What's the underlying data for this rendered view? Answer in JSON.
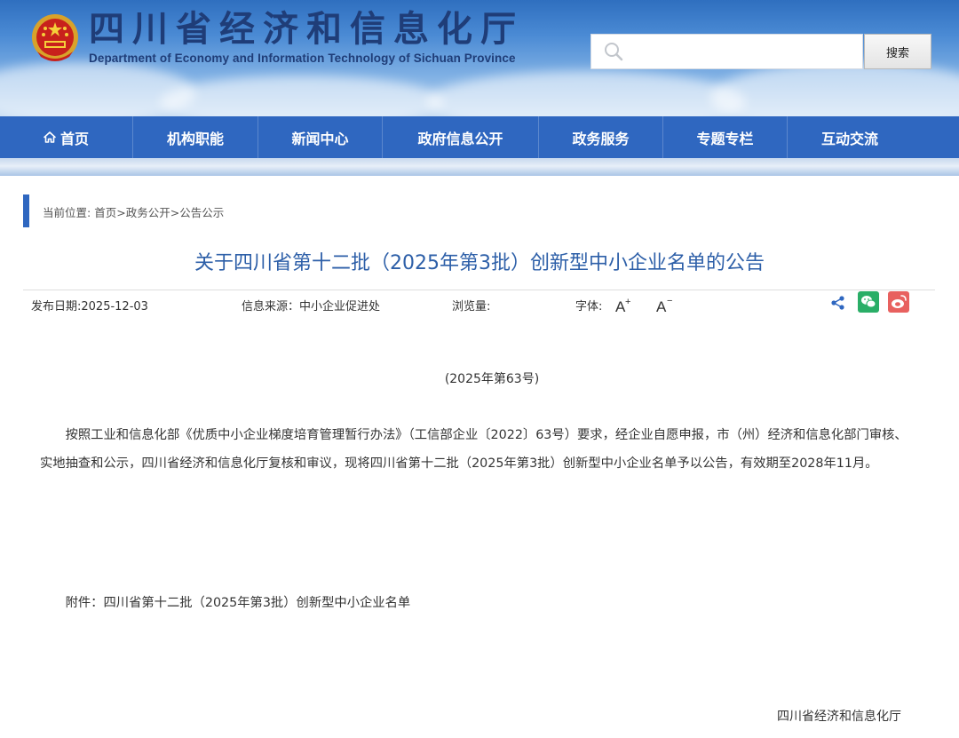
{
  "header": {
    "title_cn": "四川省经济和信息化厅",
    "title_en": "Department of Economy and Information Technology of Sichuan Province",
    "search_placeholder": "",
    "search_button": "搜索",
    "emblem_icon": "national-emblem-icon"
  },
  "nav": {
    "items": [
      {
        "label": "首页",
        "icon": "home-icon"
      },
      {
        "label": "机构职能"
      },
      {
        "label": "新闻中心"
      },
      {
        "label": "政府信息公开"
      },
      {
        "label": "政务服务"
      },
      {
        "label": "专题专栏"
      },
      {
        "label": "互动交流"
      }
    ]
  },
  "breadcrumb": {
    "prefix": "当前位置:",
    "items": [
      "首页",
      "政务公开",
      "公告公示"
    ],
    "separator": ">"
  },
  "article": {
    "title": "关于四川省第十二批（2025年第3批）创新型中小企业名单的公告",
    "publish_label": "发布日期:",
    "publish_date": "2025-12-03",
    "source_label": "信息来源：",
    "source": "中小企业促进处",
    "views_label": "浏览量:",
    "font_label": "字体:",
    "font_increase": "A+",
    "font_decrease": "A−",
    "doc_number": "(2025年第63号)",
    "body": "按照工业和信息化部《优质中小企业梯度培育管理暂行办法》（工信部企业〔2022〕63号）要求，经企业自愿申报，市（州）经济和信息化部门审核、实地抽查和公示，四川省经济和信息化厅复核和审议，现将四川省第十二批（2025年第3批）创新型中小企业名单予以公告，有效期至2028年11月。",
    "attachment": "附件：四川省第十二批（2025年第3批）创新型中小企业名单",
    "signature": "四川省经济和信息化厅"
  },
  "share": {
    "icons": [
      "share-icon",
      "wechat-icon",
      "weibo-icon"
    ]
  },
  "colors": {
    "nav_bg": "#2f67c0",
    "title": "#2d5fa8",
    "wechat": "#2aae67",
    "weibo": "#e8615f"
  }
}
